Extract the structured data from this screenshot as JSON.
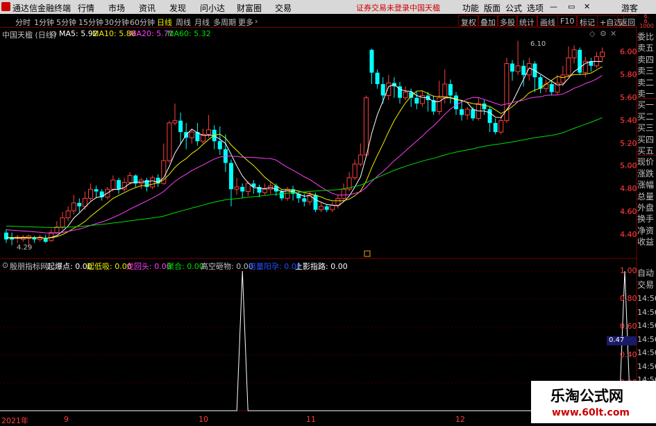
{
  "menubar": {
    "app_title": "通达信金融终端",
    "menus": [
      "行情",
      "市场",
      "资讯",
      "发现",
      "问小达",
      "财富圈",
      "交易"
    ],
    "status_trade": "证券交易未登录",
    "status_stock": "中国天楹",
    "right": [
      "功能",
      "版面",
      "公式",
      "选项"
    ],
    "user": "游客"
  },
  "toolbar": {
    "periods": [
      "分时",
      "1分钟",
      "5分钟",
      "15分钟",
      "30分钟",
      "60分钟",
      "日线",
      "周线",
      "月线",
      "多周期",
      "更多"
    ],
    "active": "日线",
    "right_buttons": [
      "复权",
      "叠加",
      "多股",
      "统计",
      "画线",
      "F10",
      "标记",
      "+自选",
      "返回"
    ]
  },
  "main": {
    "stock_label": "中国天楹 (日线)",
    "ma": [
      {
        "label": "MA5: 5.92",
        "color": "#ffffff"
      },
      {
        "label": "MA10: 5.86",
        "color": "#f0f000"
      },
      {
        "label": "MA20: 5.71",
        "color": "#ff40ff"
      },
      {
        "label": "MA60: 5.32",
        "color": "#00e000"
      }
    ],
    "high_label": "6.10",
    "low_label": "4.29",
    "y_labels": [
      "6.00",
      "5.80",
      "5.60",
      "5.40",
      "5.20",
      "5.00",
      "4.80",
      "4.60",
      "4.40"
    ]
  },
  "indicator": {
    "name": "殷朋指标网",
    "items": [
      {
        "label": "起爆点: 0.00",
        "color": "#ffffff"
      },
      {
        "label": "起低吸: 0.00",
        "color": "#f0f000"
      },
      {
        "label": "龙回头: 0.00",
        "color": "#ff40ff"
      },
      {
        "label": "聚合: 0.00",
        "color": "#00e000"
      },
      {
        "label": "高空砸物: 0.00",
        "color": "#c0c0c0"
      },
      {
        "label": "倍量阳孕: 0.00",
        "color": "#2050ff"
      },
      {
        "label": "上影指路: 0.00",
        "color": "#ffffff"
      }
    ],
    "y_labels": [
      "1.00",
      "0.80",
      "0.60",
      "0.40",
      "0.20"
    ],
    "current": "0.47"
  },
  "right_panel": {
    "items": [
      "委比",
      "卖五",
      "卖四",
      "卖三",
      "卖二",
      "卖一",
      "买一",
      "买二",
      "买三",
      "买四",
      "买五",
      "现价",
      "涨跌",
      "涨幅",
      "总量",
      "外盘",
      "换手",
      "净资",
      "收益"
    ],
    "auto_trade": [
      "自动",
      "交易"
    ],
    "times": [
      "14:56",
      "14:56",
      "14:56",
      "14:56",
      "14:56",
      "14:56",
      "14:56"
    ],
    "top_values": [
      "6.",
      "6.",
      "1000"
    ]
  },
  "dates": [
    "2021年",
    "9",
    "10",
    "11",
    "12"
  ],
  "watermark": {
    "title": "乐淘公式网",
    "url": "www.60lt.com"
  },
  "colors": {
    "up": "#ff4040",
    "down": "#00ffff",
    "ma5": "#ffffff",
    "ma10": "#f0f000",
    "ma20": "#ff40ff",
    "ma60": "#00e000",
    "frame": "#7a0000"
  },
  "chart_data": {
    "type": "candlestick",
    "y_range": [
      4.29,
      6.1
    ],
    "candles": [
      [
        4.42,
        4.36,
        4.45,
        4.33
      ],
      [
        4.38,
        4.36,
        4.42,
        4.31
      ],
      [
        4.37,
        4.38,
        4.4,
        4.33
      ],
      [
        4.36,
        4.38,
        4.4,
        4.34
      ],
      [
        4.37,
        4.39,
        4.4,
        4.29
      ],
      [
        4.38,
        4.36,
        4.39,
        4.33
      ],
      [
        4.36,
        4.38,
        4.4,
        4.34
      ],
      [
        4.37,
        4.34,
        4.4,
        4.33
      ],
      [
        4.35,
        4.42,
        4.45,
        4.34
      ],
      [
        4.42,
        4.47,
        4.52,
        4.41
      ],
      [
        4.47,
        4.55,
        4.6,
        4.45
      ],
      [
        4.55,
        4.61,
        4.65,
        4.52
      ],
      [
        4.61,
        4.68,
        4.75,
        4.58
      ],
      [
        4.68,
        4.65,
        4.72,
        4.6
      ],
      [
        4.65,
        4.72,
        4.78,
        4.62
      ],
      [
        4.72,
        4.8,
        4.85,
        4.7
      ],
      [
        4.8,
        4.78,
        4.83,
        4.72
      ],
      [
        4.78,
        4.73,
        4.8,
        4.7
      ],
      [
        4.73,
        4.8,
        4.82,
        4.71
      ],
      [
        4.8,
        4.88,
        4.92,
        4.78
      ],
      [
        4.88,
        4.8,
        4.9,
        4.76
      ],
      [
        4.8,
        4.86,
        4.9,
        4.78
      ],
      [
        4.86,
        4.92,
        4.95,
        4.84
      ],
      [
        4.92,
        4.85,
        4.93,
        4.82
      ],
      [
        4.85,
        4.88,
        4.9,
        4.8
      ],
      [
        4.88,
        4.82,
        4.9,
        4.78
      ],
      [
        4.82,
        4.9,
        4.92,
        4.8
      ],
      [
        4.9,
        4.85,
        4.93,
        4.82
      ],
      [
        4.85,
        5.05,
        5.2,
        4.84
      ],
      [
        5.05,
        5.38,
        5.4,
        5.03
      ],
      [
        5.38,
        5.4,
        5.55,
        5.36
      ],
      [
        5.4,
        5.3,
        5.47,
        5.2
      ],
      [
        5.3,
        5.25,
        5.38,
        5.15
      ],
      [
        5.25,
        5.3,
        5.32,
        5.2
      ],
      [
        5.3,
        5.22,
        5.38,
        5.18
      ],
      [
        5.22,
        5.28,
        5.33,
        5.2
      ],
      [
        5.28,
        5.32,
        5.45,
        5.25
      ],
      [
        5.32,
        5.22,
        5.36,
        5.15
      ],
      [
        5.22,
        5.15,
        5.35,
        5.1
      ],
      [
        5.15,
        5.03,
        5.28,
        4.95
      ],
      [
        5.03,
        4.8,
        5.06,
        4.65
      ],
      [
        4.8,
        4.82,
        4.9,
        4.75
      ],
      [
        4.82,
        4.78,
        4.85,
        4.72
      ],
      [
        4.78,
        4.85,
        4.87,
        4.74
      ],
      [
        4.85,
        4.82,
        4.88,
        4.76
      ],
      [
        4.82,
        4.77,
        4.84,
        4.73
      ],
      [
        4.77,
        4.8,
        4.85,
        4.75
      ],
      [
        4.8,
        4.83,
        4.86,
        4.76
      ],
      [
        4.83,
        4.78,
        4.85,
        4.74
      ],
      [
        4.78,
        4.72,
        4.8,
        4.7
      ],
      [
        4.72,
        4.8,
        4.82,
        4.7
      ],
      [
        4.8,
        4.76,
        4.83,
        4.7
      ],
      [
        4.76,
        4.72,
        4.78,
        4.68
      ],
      [
        4.72,
        4.69,
        4.76,
        4.65
      ],
      [
        4.69,
        4.75,
        4.78,
        4.66
      ],
      [
        4.75,
        4.62,
        4.77,
        4.6
      ],
      [
        4.62,
        4.65,
        4.68,
        4.6
      ],
      [
        4.65,
        4.62,
        4.67,
        4.6
      ],
      [
        4.62,
        4.66,
        4.69,
        4.6
      ],
      [
        4.66,
        4.72,
        4.75,
        4.63
      ],
      [
        4.72,
        4.8,
        4.85,
        4.7
      ],
      [
        4.8,
        4.9,
        4.95,
        4.78
      ],
      [
        4.9,
        5.02,
        5.06,
        4.88
      ],
      [
        5.02,
        5.1,
        5.2,
        5.0
      ],
      [
        5.1,
        5.6,
        5.62,
        5.08
      ],
      [
        6.02,
        5.82,
        6.03,
        5.72
      ],
      [
        5.82,
        5.72,
        5.85,
        5.68
      ],
      [
        5.72,
        5.62,
        5.78,
        5.55
      ],
      [
        5.62,
        5.73,
        5.8,
        5.58
      ],
      [
        5.73,
        5.7,
        5.78,
        5.6
      ],
      [
        5.7,
        5.6,
        5.74,
        5.55
      ],
      [
        5.6,
        5.65,
        5.7,
        5.58
      ],
      [
        5.65,
        5.6,
        5.68,
        5.52
      ],
      [
        5.6,
        5.55,
        5.65,
        5.5
      ],
      [
        5.55,
        5.62,
        5.66,
        5.52
      ],
      [
        5.62,
        5.58,
        5.65,
        5.48
      ],
      [
        5.58,
        5.48,
        5.62,
        5.45
      ],
      [
        5.48,
        5.6,
        5.75,
        5.45
      ],
      [
        5.6,
        5.72,
        5.85,
        5.55
      ],
      [
        5.72,
        5.62,
        5.76,
        5.55
      ],
      [
        5.62,
        5.5,
        5.65,
        5.45
      ],
      [
        5.5,
        5.45,
        5.58,
        5.4
      ],
      [
        5.45,
        5.5,
        5.52,
        5.41
      ],
      [
        5.5,
        5.42,
        5.52,
        5.4
      ],
      [
        5.42,
        5.55,
        5.6,
        5.4
      ],
      [
        5.55,
        5.5,
        5.58,
        5.45
      ],
      [
        5.5,
        5.38,
        5.52,
        5.3
      ],
      [
        5.38,
        5.3,
        5.42,
        5.28
      ],
      [
        5.3,
        5.4,
        5.45,
        5.28
      ],
      [
        5.4,
        5.9,
        5.95,
        5.38
      ],
      [
        5.9,
        5.83,
        5.93,
        5.75
      ],
      [
        5.83,
        5.88,
        6.1,
        5.8
      ],
      [
        5.88,
        5.8,
        5.93,
        5.7
      ],
      [
        5.8,
        5.9,
        5.95,
        5.75
      ],
      [
        5.9,
        5.78,
        5.92,
        5.65
      ],
      [
        5.78,
        5.68,
        5.8,
        5.64
      ],
      [
        5.68,
        5.72,
        5.76,
        5.65
      ],
      [
        5.72,
        5.65,
        5.75,
        5.62
      ],
      [
        5.65,
        5.73,
        5.8,
        5.63
      ],
      [
        5.73,
        5.8,
        5.88,
        5.7
      ],
      [
        5.8,
        5.95,
        6.05,
        5.78
      ],
      [
        5.95,
        6.02,
        6.06,
        5.9
      ],
      [
        6.02,
        5.82,
        6.04,
        5.8
      ],
      [
        5.82,
        5.92,
        5.96,
        5.78
      ],
      [
        5.92,
        5.88,
        5.95,
        5.83
      ],
      [
        5.88,
        5.96,
        6.0,
        5.86
      ],
      [
        5.96,
        6.0,
        6.04,
        5.92
      ]
    ],
    "spikes": [
      42,
      110
    ]
  }
}
